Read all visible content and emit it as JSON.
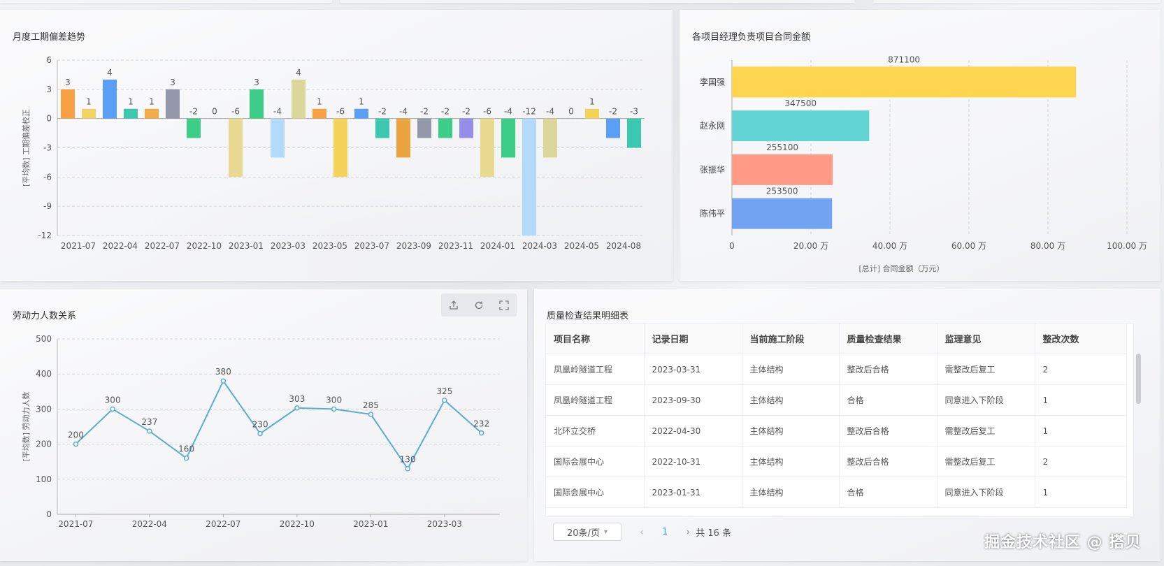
{
  "panels": {
    "deviation_title": "月度工期偏差趋势",
    "contract_title": "各项目经理负责项目合同金额",
    "labor_title": "劳动力人数关系",
    "quality_title": "质量检查结果明细表"
  },
  "toolbar": {
    "icons": [
      "export-icon",
      "refresh-icon",
      "fullscreen-icon"
    ]
  },
  "chart_data": [
    {
      "type": "bar",
      "title": "月度工期偏差趋势",
      "ylabel": "[平均数] 工期偏差校正",
      "ylim": [
        -12,
        6
      ],
      "yticks": [
        6,
        3,
        0,
        -3,
        -6,
        -9,
        -12
      ],
      "x_tick_labels": [
        "2021-07",
        "2022-04",
        "2022-07",
        "2022-10",
        "2023-01",
        "2023-03",
        "2023-05",
        "2023-07",
        "2023-09",
        "2023-11",
        "2024-01",
        "2024-03",
        "2024-05",
        "2024-08"
      ],
      "values": [
        3,
        1,
        4,
        1,
        1,
        3,
        -2,
        0,
        -6,
        3,
        -4,
        4,
        1,
        -6,
        1,
        -2,
        -4,
        -2,
        -2,
        -2,
        -6,
        -4,
        -12,
        -4,
        0,
        1,
        -2,
        -3
      ],
      "colors": [
        "#f7a044",
        "#f3d365",
        "#5b9ef5",
        "#3cc8ae",
        "#f2ac45",
        "#9597aa",
        "#3ccd88",
        "#e0e0e0",
        "#ead990",
        "#3dcd88",
        "#b4dafb",
        "#dbd699",
        "#f7a044",
        "#f5d35a",
        "#5b9ef5",
        "#3cc8ae",
        "#eba440",
        "#9597aa",
        "#3ccd88",
        "#958de8",
        "#ead990",
        "#3ccd88",
        "#b4dafb",
        "#dbd699",
        "#e0e0e0",
        "#f5d35a",
        "#5b9ef5",
        "#3cc8ae"
      ],
      "grid": true
    },
    {
      "type": "bar",
      "orientation": "horizontal",
      "title": "各项目经理负责项目合同金额",
      "categories": [
        "李国强",
        "赵永刚",
        "张振华",
        "陈伟平"
      ],
      "values": [
        871100,
        347500,
        255100,
        253500
      ],
      "colors": [
        "#fed54f",
        "#62d4d3",
        "#ff9a87",
        "#72a3f2"
      ],
      "xlabel": "[总计] 合同金额（万元）",
      "xticks": [
        "0",
        "20.00 万",
        "40.00 万",
        "60.00 万",
        "80.00 万",
        "100.00 万"
      ],
      "xlim": [
        0,
        1000000
      ],
      "grid": true
    },
    {
      "type": "line",
      "title": "劳动力人数关系",
      "ylabel": "[平均数] 劳动力人数",
      "ylim": [
        0,
        500
      ],
      "yticks": [
        0,
        100,
        200,
        300,
        400,
        500
      ],
      "x_tick_labels": [
        "2021-07",
        "2022-04",
        "2022-07",
        "2022-10",
        "2023-01",
        "2023-03"
      ],
      "values": [
        200,
        300,
        237,
        160,
        380,
        230,
        303,
        300,
        285,
        130,
        325,
        232
      ],
      "color": "#5aacd7",
      "grid": true
    }
  ],
  "table": {
    "headers": [
      "项目名称",
      "记录日期",
      "当前施工阶段",
      "质量检查结果",
      "监理意见",
      "整改次数"
    ],
    "rows": [
      [
        "凤凰岭隧道工程",
        "2023-03-31",
        "主体结构",
        "整改后合格",
        "需整改后复工",
        "2"
      ],
      [
        "凤凰岭隧道工程",
        "2023-09-30",
        "主体结构",
        "合格",
        "同意进入下阶段",
        "1"
      ],
      [
        "北环立交桥",
        "2022-04-30",
        "主体结构",
        "整改后合格",
        "需整改后复工",
        "1"
      ],
      [
        "国际会展中心",
        "2022-10-31",
        "主体结构",
        "整改后合格",
        "需整改后复工",
        "2"
      ],
      [
        "国际会展中心",
        "2023-01-31",
        "主体结构",
        "合格",
        "同意进入下阶段",
        "1"
      ]
    ]
  },
  "pagination": {
    "page_size": "20条/页",
    "current_page": "1",
    "total": "共 16 条"
  },
  "brand": "掘金技术社区 @ 搭贝"
}
